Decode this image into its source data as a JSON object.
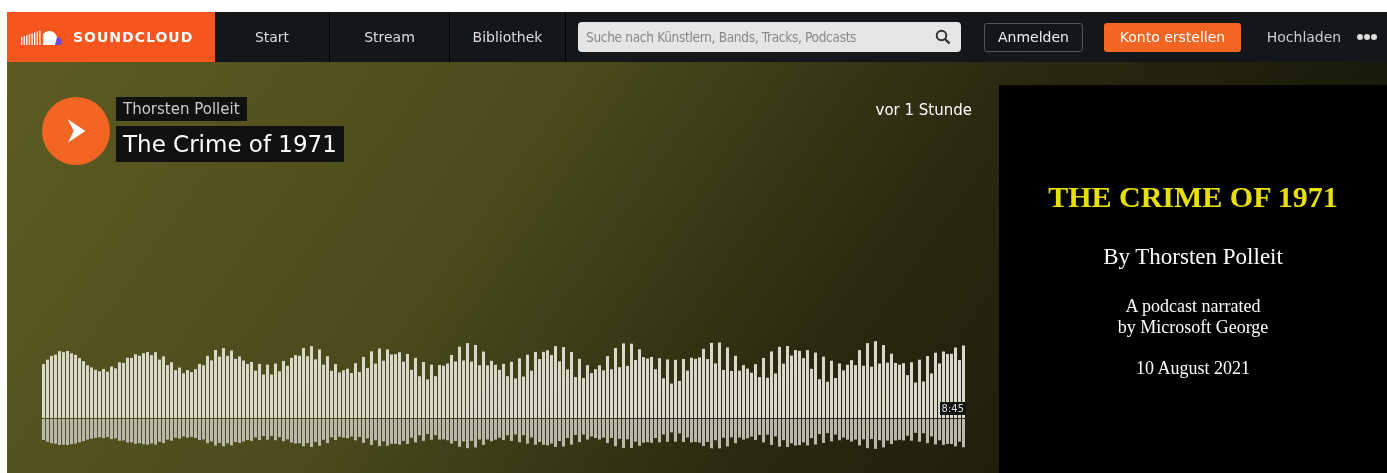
{
  "header": {
    "logo": "SOUNDCLOUD",
    "nav": [
      {
        "label": "Start",
        "selected": false
      },
      {
        "label": "Stream",
        "selected": false
      },
      {
        "label": "Bibliothek",
        "selected": false
      }
    ],
    "search": {
      "placeholder": "Suche nach Künstlern, Bands, Tracks, Podcasts"
    },
    "sign_in": "Anmelden",
    "create_account": "Konto erstellen",
    "upload": "Hochladen"
  },
  "track": {
    "artist": "Thorsten Polleit",
    "title": "The Crime of 1971",
    "posted": "vor 1 Stunde",
    "duration": "8:45",
    "artwork": {
      "title": "THE CRIME OF 1971",
      "byline": "By Thorsten Polleit",
      "note_line_1": "A podcast narrated",
      "note_line_2": "by Microsoft George",
      "date": "10 August 2021"
    }
  }
}
